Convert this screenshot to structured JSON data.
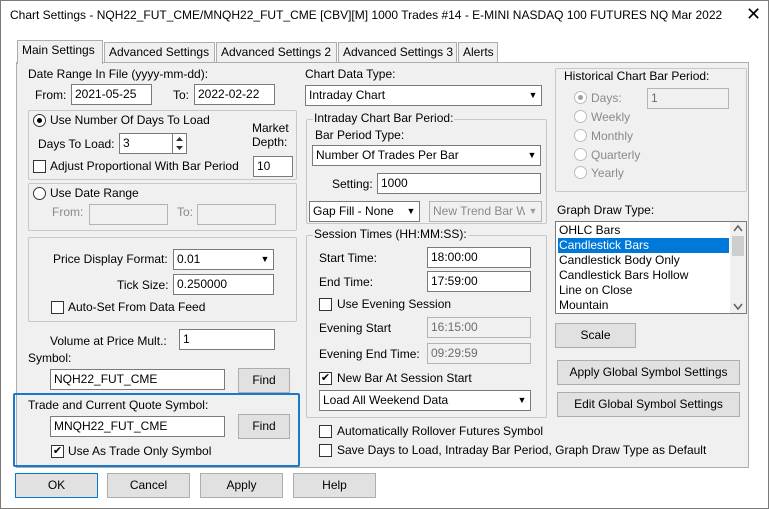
{
  "window": {
    "title": "Chart Settings - NQH22_FUT_CME/MNQH22_FUT_CME [CBV][M]  1000 Trades  #14 - E-MINI NASDAQ 100 FUTURES NQ Mar 2022",
    "close_glyph": "✕"
  },
  "tabs": [
    "Main Settings",
    "Advanced Settings",
    "Advanced Settings 2",
    "Advanced Settings 3",
    "Alerts"
  ],
  "date_range": {
    "label": "Date Range In File (yyyy-mm-dd):",
    "from_label": "From:",
    "from_value": "2021-05-25",
    "to_label": "To:",
    "to_value": "2022-02-22"
  },
  "days_group": {
    "use_days_label": "Use Number Of Days To Load",
    "days_to_load_label": "Days To Load:",
    "days_to_load_value": "3",
    "market_depth_label_1": "Market",
    "market_depth_label_2": "Depth:",
    "market_depth_value": "10",
    "adjust_label": "Adjust Proportional With Bar Period"
  },
  "date_range_group": {
    "label": "Use Date Range",
    "from_label": "From:",
    "to_label": "To:"
  },
  "price_group": {
    "price_format_label": "Price Display Format:",
    "price_format_value": "0.01",
    "tick_size_label": "Tick Size:",
    "tick_size_value": "0.250000",
    "autoset_label": "Auto-Set From Data Feed"
  },
  "symbol": {
    "vap_label": "Volume at Price Mult.:",
    "vap_value": "1",
    "symbol_label": "Symbol:",
    "symbol_value": "NQH22_FUT_CME",
    "find_label": "Find"
  },
  "trade_symbol": {
    "label": "Trade and Current Quote Symbol:",
    "value": "MNQH22_FUT_CME",
    "find_label": "Find",
    "trade_only_label": "Use As Trade Only Symbol"
  },
  "chart_data": {
    "type_label": "Chart Data Type:",
    "type_value": "Intraday Chart"
  },
  "intraday": {
    "group_label": "Intraday Chart Bar Period:",
    "bar_period_type_label": "Bar Period Type:",
    "bar_period_type_value": "Number Of Trades Per Bar",
    "setting_label": "Setting:",
    "setting_value": "1000",
    "gap_fill_value": "Gap Fill - None",
    "new_trend_value": "New Trend Bar W"
  },
  "session": {
    "group_label": "Session Times (HH:MM:SS):",
    "start_label": "Start Time:",
    "start_value": "18:00:00",
    "end_label": "End Time:",
    "end_value": "17:59:00",
    "use_evening_label": "Use Evening Session",
    "evening_start_label": "Evening Start",
    "evening_start_value": "16:15:00",
    "evening_end_label": "Evening End Time:",
    "evening_end_value": "09:29:59",
    "new_bar_label": "New Bar At Session Start",
    "weekend_value": "Load All Weekend Data"
  },
  "options": {
    "rollover_label": "Automatically Rollover Futures Symbol",
    "save_default_label": "Save Days to Load, Intraday Bar Period, Graph Draw Type as Default"
  },
  "historical": {
    "label": "Historical Chart Bar Period:",
    "days_label": "Days:",
    "days_value": "1",
    "weekly_label": "Weekly",
    "monthly_label": "Monthly",
    "quarterly_label": "Quarterly",
    "yearly_label": "Yearly"
  },
  "graph_draw": {
    "label": "Graph Draw Type:",
    "items": [
      "OHLC Bars",
      "Candlestick Bars",
      "Candlestick Body Only",
      "Candlestick Bars Hollow",
      "Line on Close",
      "Mountain"
    ],
    "selected": "Candlestick Bars"
  },
  "buttons": {
    "scale": "Scale",
    "apply_global": "Apply Global Symbol Settings",
    "edit_global": "Edit Global Symbol Settings",
    "ok": "OK",
    "cancel": "Cancel",
    "apply": "Apply",
    "help": "Help"
  },
  "colors": {
    "selection": "#0078d7",
    "focus_border": "#1979ca",
    "panel_bg": "#f0f0f0"
  }
}
